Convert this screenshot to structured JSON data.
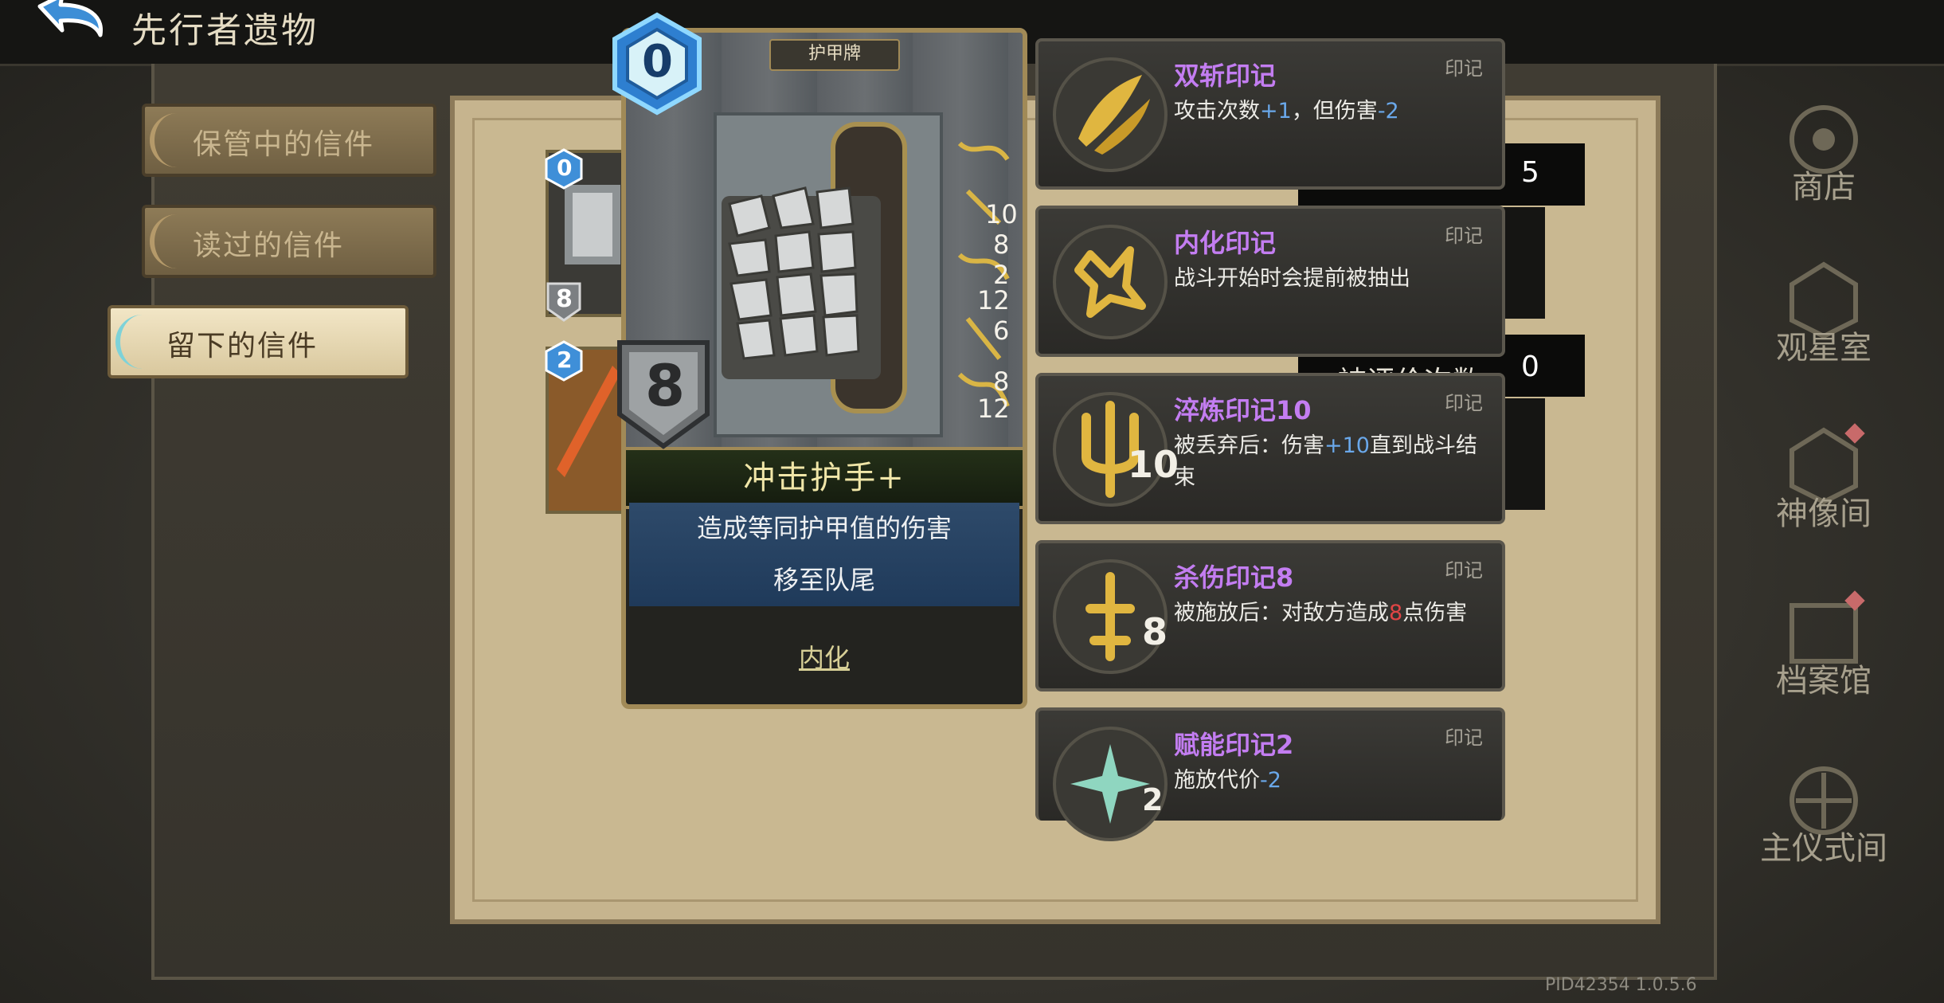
{
  "header": {
    "title": "先行者遗物"
  },
  "tabs": [
    {
      "label": "保管中的信件",
      "active": false
    },
    {
      "label": "读过的信件",
      "active": false
    },
    {
      "label": "留下的信件",
      "active": true
    }
  ],
  "mini_cards": [
    {
      "cost": "0",
      "armor": "8"
    },
    {
      "cost": "2"
    }
  ],
  "card": {
    "type": "护甲牌",
    "cost": "0",
    "armor": "8",
    "name": "冲击护手+",
    "desc_line1": "造成等同护甲值的伤害",
    "desc_line2": "移至队尾",
    "keyword": "内化",
    "sigil_numbers": [
      "10",
      "8",
      "2",
      "12",
      "6",
      "8",
      "12"
    ]
  },
  "sigils": [
    {
      "title": "双斩印记",
      "tag": "印记",
      "desc_parts": [
        "攻击次数",
        "+1",
        "，但伤害",
        "-2"
      ],
      "icon": "double-slash-icon",
      "num": ""
    },
    {
      "title": "内化印记",
      "tag": "印记",
      "desc": "战斗开始时会提前被抽出",
      "icon": "internalize-icon",
      "num": ""
    },
    {
      "title": "淬炼印记10",
      "tag": "印记",
      "desc_parts": [
        "被丢弃后：伤害",
        "+10",
        "直到战斗结束"
      ],
      "icon": "temper-icon",
      "num": "10"
    },
    {
      "title": "杀伤印记8",
      "tag": "印记",
      "desc_parts": [
        "被施放后：对敌方造成",
        "8",
        "点伤害"
      ],
      "icon": "kill-icon",
      "num": "8"
    },
    {
      "title": "赋能印记2",
      "tag": "印记",
      "desc_parts": [
        "施放代价",
        "-2"
      ],
      "icon": "empower-icon",
      "num": "2"
    }
  ],
  "stats": {
    "value1": "5",
    "label2": "被评价次数：",
    "value2": "0"
  },
  "nav": [
    {
      "label": "商店",
      "icon": "shop-icon"
    },
    {
      "label": "观星室",
      "icon": "observatory-icon"
    },
    {
      "label": "神像间",
      "icon": "statue-room-icon"
    },
    {
      "label": "档案馆",
      "icon": "archive-icon"
    },
    {
      "label": "主仪式间",
      "icon": "ritual-room-icon"
    }
  ],
  "version": "PID42354  1.0.5.6",
  "colors": {
    "sigil_title": "#c37df1",
    "positive_num": "#6aa8ea",
    "damage_num": "#e04545"
  }
}
